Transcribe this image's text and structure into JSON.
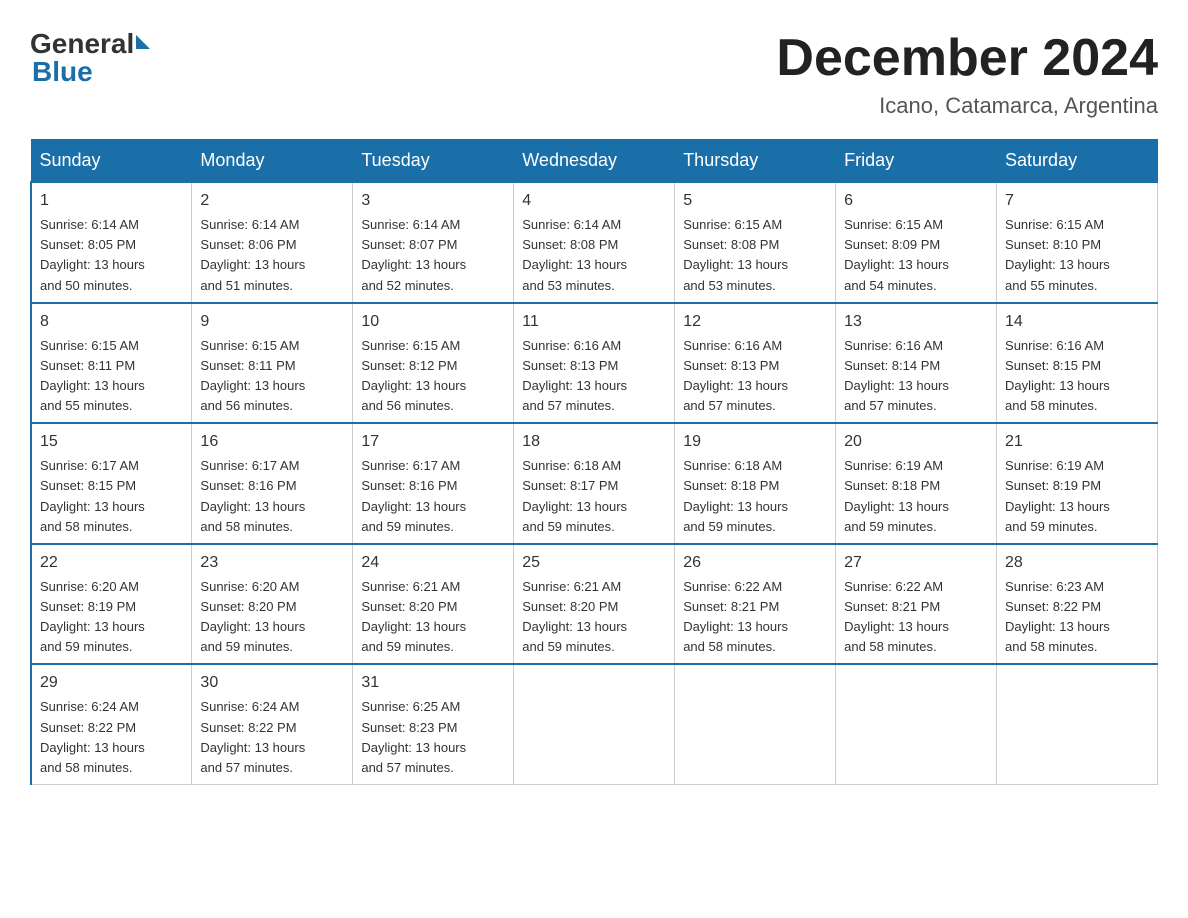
{
  "header": {
    "logo_general": "General",
    "logo_blue": "Blue",
    "month": "December 2024",
    "location": "Icano, Catamarca, Argentina"
  },
  "days_of_week": [
    "Sunday",
    "Monday",
    "Tuesday",
    "Wednesday",
    "Thursday",
    "Friday",
    "Saturday"
  ],
  "weeks": [
    [
      {
        "day": "1",
        "sunrise": "6:14 AM",
        "sunset": "8:05 PM",
        "daylight": "13 hours and 50 minutes."
      },
      {
        "day": "2",
        "sunrise": "6:14 AM",
        "sunset": "8:06 PM",
        "daylight": "13 hours and 51 minutes."
      },
      {
        "day": "3",
        "sunrise": "6:14 AM",
        "sunset": "8:07 PM",
        "daylight": "13 hours and 52 minutes."
      },
      {
        "day": "4",
        "sunrise": "6:14 AM",
        "sunset": "8:08 PM",
        "daylight": "13 hours and 53 minutes."
      },
      {
        "day": "5",
        "sunrise": "6:15 AM",
        "sunset": "8:08 PM",
        "daylight": "13 hours and 53 minutes."
      },
      {
        "day": "6",
        "sunrise": "6:15 AM",
        "sunset": "8:09 PM",
        "daylight": "13 hours and 54 minutes."
      },
      {
        "day": "7",
        "sunrise": "6:15 AM",
        "sunset": "8:10 PM",
        "daylight": "13 hours and 55 minutes."
      }
    ],
    [
      {
        "day": "8",
        "sunrise": "6:15 AM",
        "sunset": "8:11 PM",
        "daylight": "13 hours and 55 minutes."
      },
      {
        "day": "9",
        "sunrise": "6:15 AM",
        "sunset": "8:11 PM",
        "daylight": "13 hours and 56 minutes."
      },
      {
        "day": "10",
        "sunrise": "6:15 AM",
        "sunset": "8:12 PM",
        "daylight": "13 hours and 56 minutes."
      },
      {
        "day": "11",
        "sunrise": "6:16 AM",
        "sunset": "8:13 PM",
        "daylight": "13 hours and 57 minutes."
      },
      {
        "day": "12",
        "sunrise": "6:16 AM",
        "sunset": "8:13 PM",
        "daylight": "13 hours and 57 minutes."
      },
      {
        "day": "13",
        "sunrise": "6:16 AM",
        "sunset": "8:14 PM",
        "daylight": "13 hours and 57 minutes."
      },
      {
        "day": "14",
        "sunrise": "6:16 AM",
        "sunset": "8:15 PM",
        "daylight": "13 hours and 58 minutes."
      }
    ],
    [
      {
        "day": "15",
        "sunrise": "6:17 AM",
        "sunset": "8:15 PM",
        "daylight": "13 hours and 58 minutes."
      },
      {
        "day": "16",
        "sunrise": "6:17 AM",
        "sunset": "8:16 PM",
        "daylight": "13 hours and 58 minutes."
      },
      {
        "day": "17",
        "sunrise": "6:17 AM",
        "sunset": "8:16 PM",
        "daylight": "13 hours and 59 minutes."
      },
      {
        "day": "18",
        "sunrise": "6:18 AM",
        "sunset": "8:17 PM",
        "daylight": "13 hours and 59 minutes."
      },
      {
        "day": "19",
        "sunrise": "6:18 AM",
        "sunset": "8:18 PM",
        "daylight": "13 hours and 59 minutes."
      },
      {
        "day": "20",
        "sunrise": "6:19 AM",
        "sunset": "8:18 PM",
        "daylight": "13 hours and 59 minutes."
      },
      {
        "day": "21",
        "sunrise": "6:19 AM",
        "sunset": "8:19 PM",
        "daylight": "13 hours and 59 minutes."
      }
    ],
    [
      {
        "day": "22",
        "sunrise": "6:20 AM",
        "sunset": "8:19 PM",
        "daylight": "13 hours and 59 minutes."
      },
      {
        "day": "23",
        "sunrise": "6:20 AM",
        "sunset": "8:20 PM",
        "daylight": "13 hours and 59 minutes."
      },
      {
        "day": "24",
        "sunrise": "6:21 AM",
        "sunset": "8:20 PM",
        "daylight": "13 hours and 59 minutes."
      },
      {
        "day": "25",
        "sunrise": "6:21 AM",
        "sunset": "8:20 PM",
        "daylight": "13 hours and 59 minutes."
      },
      {
        "day": "26",
        "sunrise": "6:22 AM",
        "sunset": "8:21 PM",
        "daylight": "13 hours and 58 minutes."
      },
      {
        "day": "27",
        "sunrise": "6:22 AM",
        "sunset": "8:21 PM",
        "daylight": "13 hours and 58 minutes."
      },
      {
        "day": "28",
        "sunrise": "6:23 AM",
        "sunset": "8:22 PM",
        "daylight": "13 hours and 58 minutes."
      }
    ],
    [
      {
        "day": "29",
        "sunrise": "6:24 AM",
        "sunset": "8:22 PM",
        "daylight": "13 hours and 58 minutes."
      },
      {
        "day": "30",
        "sunrise": "6:24 AM",
        "sunset": "8:22 PM",
        "daylight": "13 hours and 57 minutes."
      },
      {
        "day": "31",
        "sunrise": "6:25 AM",
        "sunset": "8:23 PM",
        "daylight": "13 hours and 57 minutes."
      },
      null,
      null,
      null,
      null
    ]
  ],
  "labels": {
    "sunrise": "Sunrise:",
    "sunset": "Sunset:",
    "daylight": "Daylight:"
  }
}
